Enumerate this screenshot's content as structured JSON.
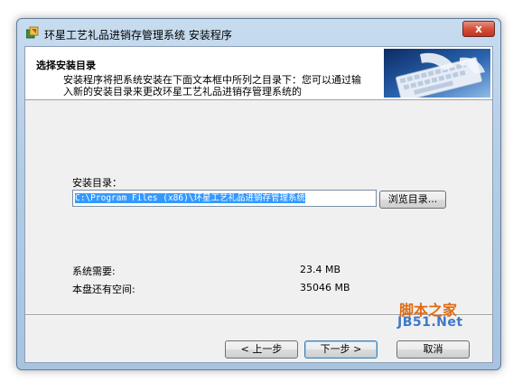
{
  "window": {
    "title": "环星工艺礼品进销存管理系统 安装程序",
    "close_label": "x"
  },
  "header": {
    "title": "选择安装目录",
    "description": "安装程序将把系统安装在下面文本框中所列之目录下：您可以通过输入新的安装目录来更改环星工艺礼品进销存管理系统的",
    "image": "keyboard-photo"
  },
  "install": {
    "dir_label": "安装目录：",
    "path_value": "C:\\Program Files (x86)\\环星工艺礼品进销存管理系统",
    "browse_label": "浏览目录..."
  },
  "space": {
    "required_label": "系统需要:",
    "required_value": "23.4 MB",
    "available_label": "本盘还有空间:",
    "available_value": "35046 MB"
  },
  "buttons": {
    "back": "< 上一步",
    "next": "下一步 >",
    "cancel": "取消"
  },
  "watermark": {
    "line1": "脚本之家",
    "line2": "JB51.Net"
  },
  "colors": {
    "selection": "#3399ff",
    "close_button": "#c2331e",
    "watermark_orange": "#e06a12",
    "watermark_blue": "#3f78c8"
  }
}
